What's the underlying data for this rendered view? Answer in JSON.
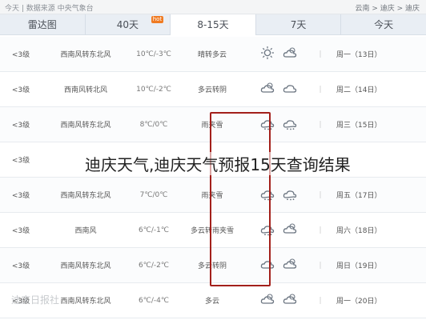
{
  "topbar": {
    "left": "今天 | 数据来源 中央气象台",
    "right": "云南 > 迪庆 > 迪庆"
  },
  "tabs": [
    {
      "label": "雷达图"
    },
    {
      "label": "40天",
      "badge": "hot"
    },
    {
      "label": "8-15天"
    },
    {
      "label": "7天"
    },
    {
      "label": "今天"
    }
  ],
  "rows": [
    {
      "level": "<3级",
      "wind": "西南风转东北风",
      "temp": "10℃/-3℃",
      "cond": "晴转多云",
      "icons": [
        "sun",
        "partly-cloudy"
      ],
      "day": "周一（13日）"
    },
    {
      "level": "<3级",
      "wind": "西南风转北风",
      "temp": "10℃/-2℃",
      "cond": "多云转阴",
      "icons": [
        "partly-cloudy",
        "cloudy"
      ],
      "day": "周二（14日）"
    },
    {
      "level": "<3级",
      "wind": "西南风转东北风",
      "temp": "8℃/0℃",
      "cond": "雨夹雪",
      "icons": [
        "sleet",
        "sleet"
      ],
      "day": "周三（15日）"
    },
    {
      "level": "<3级",
      "wind": "",
      "temp": "",
      "cond": "",
      "icons": [],
      "day": ""
    },
    {
      "level": "<3级",
      "wind": "西南风转东北风",
      "temp": "7℃/0℃",
      "cond": "雨夹雪",
      "icons": [
        "sleet",
        "sleet"
      ],
      "day": "周五（17日）"
    },
    {
      "level": "<3级",
      "wind": "西南风",
      "temp": "6℃/-1℃",
      "cond": "多云转雨夹雪",
      "icons": [
        "sleet",
        "partly-cloudy"
      ],
      "day": "周六（18日）"
    },
    {
      "level": "<3级",
      "wind": "西南风转东北风",
      "temp": "6℃/-2℃",
      "cond": "多云转阴",
      "icons": [
        "cloudy",
        "partly-cloudy"
      ],
      "day": "周日（19日）"
    },
    {
      "level": "<3级",
      "wind": "西南风转东北风",
      "temp": "6℃/-4℃",
      "cond": "多云",
      "icons": [
        "partly-cloudy",
        "partly-cloudy"
      ],
      "day": "周一（20日）"
    }
  ],
  "overlay_title": "迪庆天气,迪庆天气预报15天查询结果",
  "watermark": "迪庆日报社",
  "colors": {
    "highlight": "#a3201b",
    "tab_bg": "#e9eef4",
    "hot_badge": "#f07b22"
  }
}
